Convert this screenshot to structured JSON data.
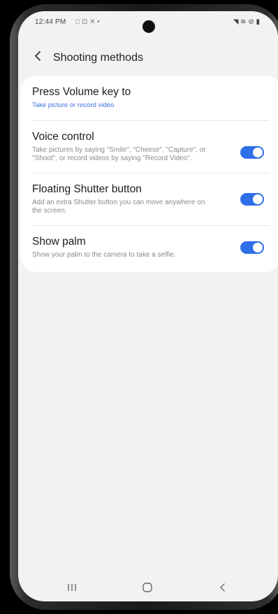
{
  "status_bar": {
    "time": "12:44 PM",
    "notifications": "□ ⊡ ✕ •",
    "system_icons": "◥ ≋ ⊘ ▮"
  },
  "header": {
    "back_icon": "chevron-left-icon",
    "title": "Shooting methods"
  },
  "settings": [
    {
      "title": "Press Volume key to",
      "subtitle": "Take picture or record video",
      "subtitle_color": "#3e6fd8",
      "has_toggle": false
    },
    {
      "title": "Voice control",
      "subtitle": "Take pictures by saying \"Smile\", \"Cheese\", \"Capture\", or \"Shoot\", or record videos by saying \"Record Video\".",
      "has_toggle": true,
      "toggle_on": true
    },
    {
      "title": "Floating Shutter button",
      "subtitle": "Add an extra Shutter button you can move anywhere on the screen.",
      "has_toggle": true,
      "toggle_on": true
    },
    {
      "title": "Show palm",
      "subtitle": "Show your palm to the camera to take a selfie.",
      "has_toggle": true,
      "toggle_on": true
    }
  ],
  "colors": {
    "accent": "#2f6fe8",
    "background": "#f2f2f2",
    "card": "#ffffff"
  },
  "nav_bar": {
    "recents": "|||",
    "home": "○",
    "back": "‹"
  }
}
